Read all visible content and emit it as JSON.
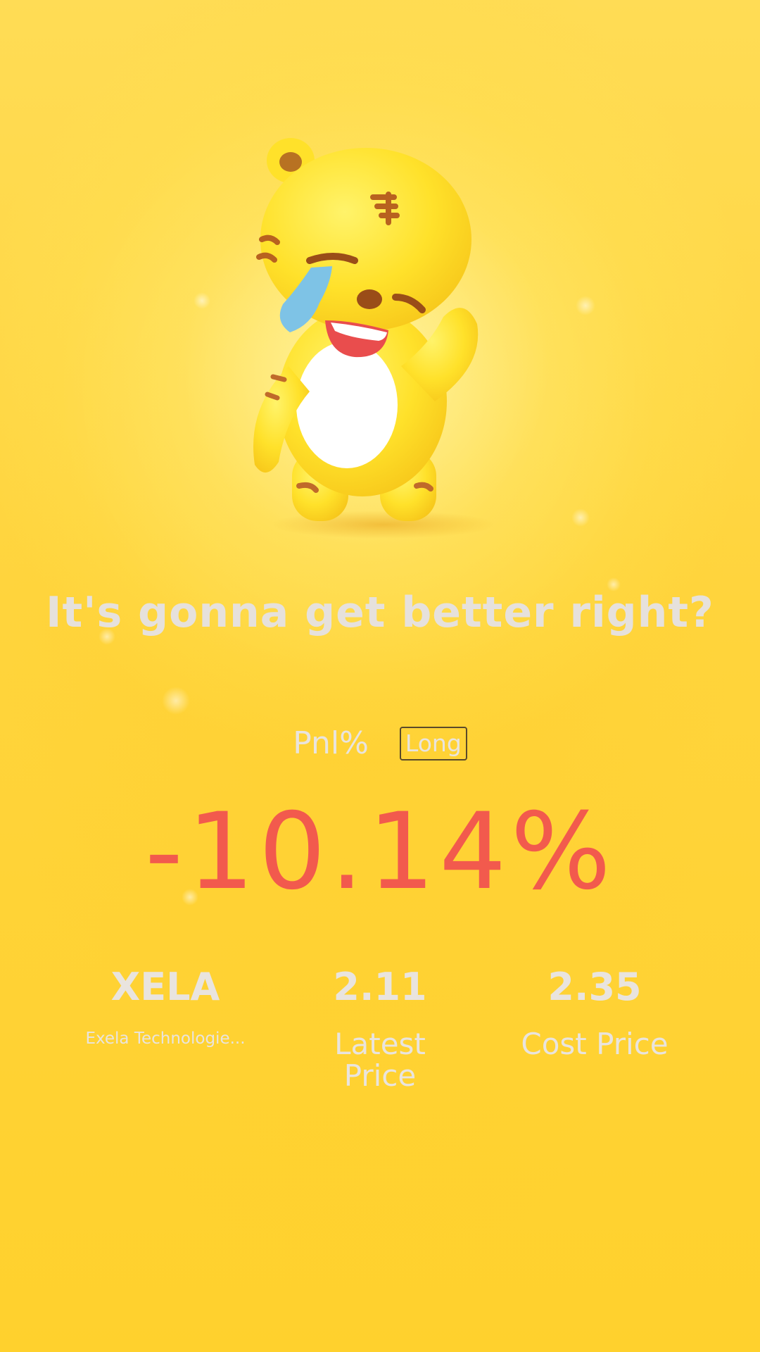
{
  "headline": "It's gonna get better right?",
  "pnl": {
    "label": "Pnl%",
    "direction": "Long",
    "value": "-10.14%",
    "value_color": "#f25a4d"
  },
  "stock": {
    "ticker": "XELA",
    "name": "Exela Technologie..."
  },
  "latest_price": {
    "value": "2.11",
    "label_line1": "Latest",
    "label_line2": "Price"
  },
  "cost_price": {
    "value": "2.35",
    "label": "Cost Price"
  },
  "mascot": {
    "icon": "crying-tiger-mascot-icon"
  },
  "colors": {
    "background": "#ffd43b",
    "text_light": "#e9e4de",
    "loss_red": "#f25a4d"
  }
}
